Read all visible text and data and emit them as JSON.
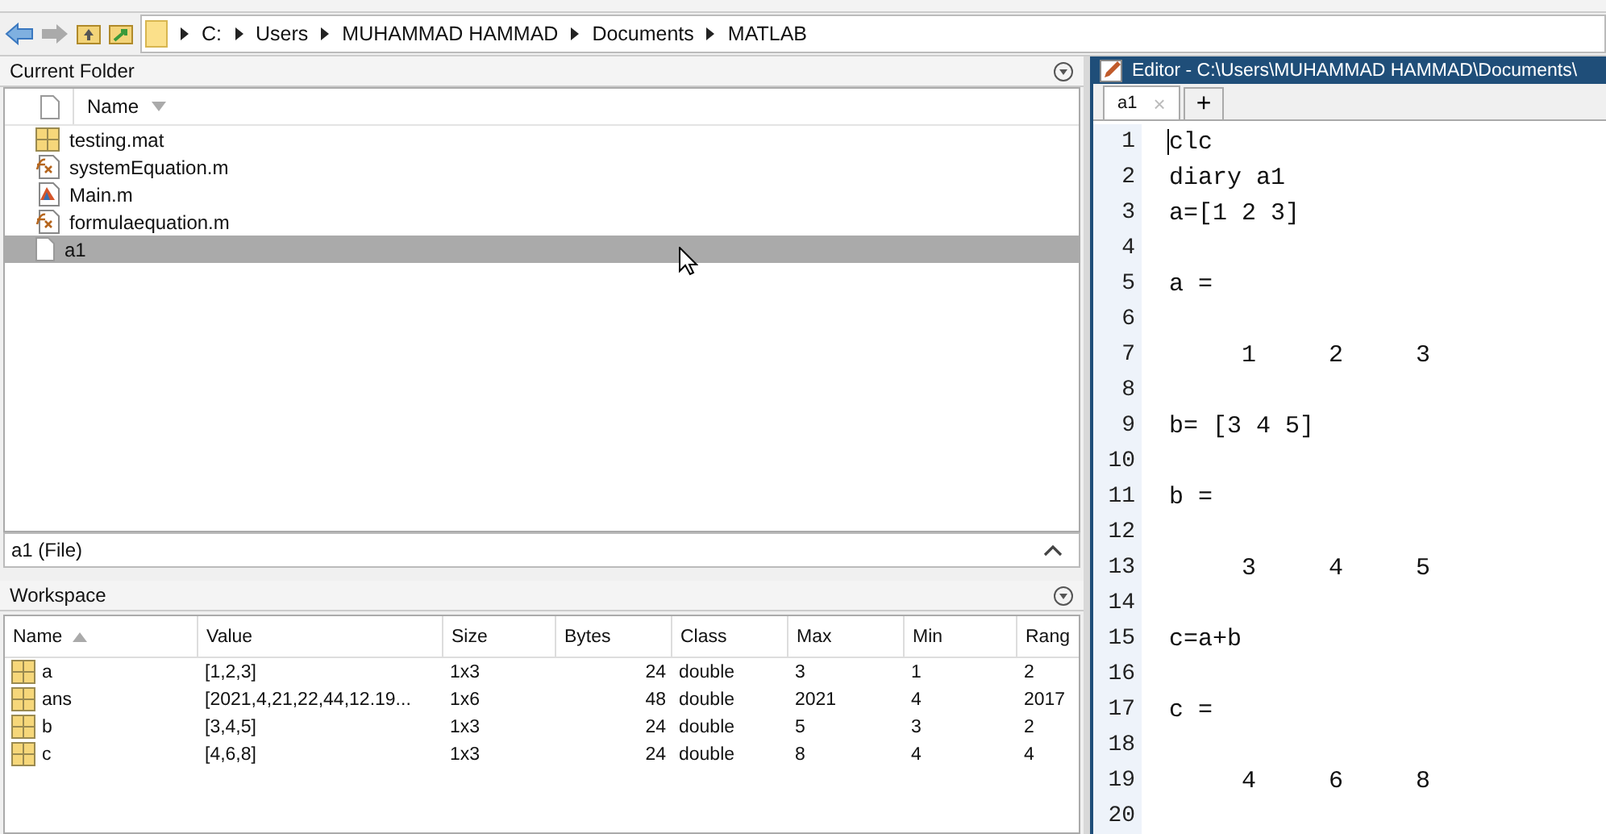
{
  "address_bar": {
    "segments": [
      "C:",
      "Users",
      "MUHAMMAD HAMMAD",
      "Documents",
      "MATLAB"
    ]
  },
  "current_folder": {
    "title": "Current Folder",
    "column": "Name",
    "files": [
      {
        "name": "testing.mat",
        "kind": "mat",
        "selected": false
      },
      {
        "name": "systemEquation.m",
        "kind": "function",
        "selected": false
      },
      {
        "name": "Main.m",
        "kind": "script",
        "selected": false
      },
      {
        "name": "formulaequation.m",
        "kind": "function",
        "selected": false
      },
      {
        "name": "a1",
        "kind": "text",
        "selected": true
      }
    ]
  },
  "details": {
    "label": "a1  (File)"
  },
  "workspace": {
    "title": "Workspace",
    "columns": [
      {
        "label": "Name"
      },
      {
        "label": "Value"
      },
      {
        "label": "Size"
      },
      {
        "label": "Bytes"
      },
      {
        "label": "Class"
      },
      {
        "label": "Max"
      },
      {
        "label": "Min"
      },
      {
        "label": "Rang"
      }
    ],
    "rows": [
      [
        "a",
        "[1,2,3]",
        "1x3",
        "24",
        "double",
        "3",
        "1",
        "2"
      ],
      [
        "ans",
        "[2021,4,21,22,44,12.19...",
        "1x6",
        "48",
        "double",
        "2021",
        "4",
        "2017"
      ],
      [
        "b",
        "[3,4,5]",
        "1x3",
        "24",
        "double",
        "5",
        "3",
        "2"
      ],
      [
        "c",
        "[4,6,8]",
        "1x3",
        "24",
        "double",
        "8",
        "4",
        "4"
      ]
    ]
  },
  "editor": {
    "title": "Editor - C:\\Users\\MUHAMMAD HAMMAD\\Documents\\",
    "tabs": [
      {
        "label": "a1",
        "selected": true
      }
    ],
    "add_tab": "+",
    "close_tab": "×",
    "lines": [
      {
        "number": "1",
        "code": "clc"
      },
      {
        "number": "2",
        "code": "diary a1"
      },
      {
        "number": "3",
        "code": "a=[1 2 3]"
      },
      {
        "number": "4"
      },
      {
        "number": "5",
        "code": "a ="
      },
      {
        "number": "6"
      },
      {
        "number": "7",
        "code": "     1     2     3"
      },
      {
        "number": "8"
      },
      {
        "number": "9",
        "code": "b= [3 4 5]"
      },
      {
        "number": "10"
      },
      {
        "number": "11",
        "code": "b ="
      },
      {
        "number": "12"
      },
      {
        "number": "13",
        "code": "     3     4     5"
      },
      {
        "number": "14"
      },
      {
        "number": "15",
        "code": "c=a+b"
      },
      {
        "number": "16"
      },
      {
        "number": "17",
        "code": "c ="
      },
      {
        "number": "18"
      },
      {
        "number": "19",
        "code": "     4     6     8"
      },
      {
        "number": "20"
      }
    ]
  }
}
